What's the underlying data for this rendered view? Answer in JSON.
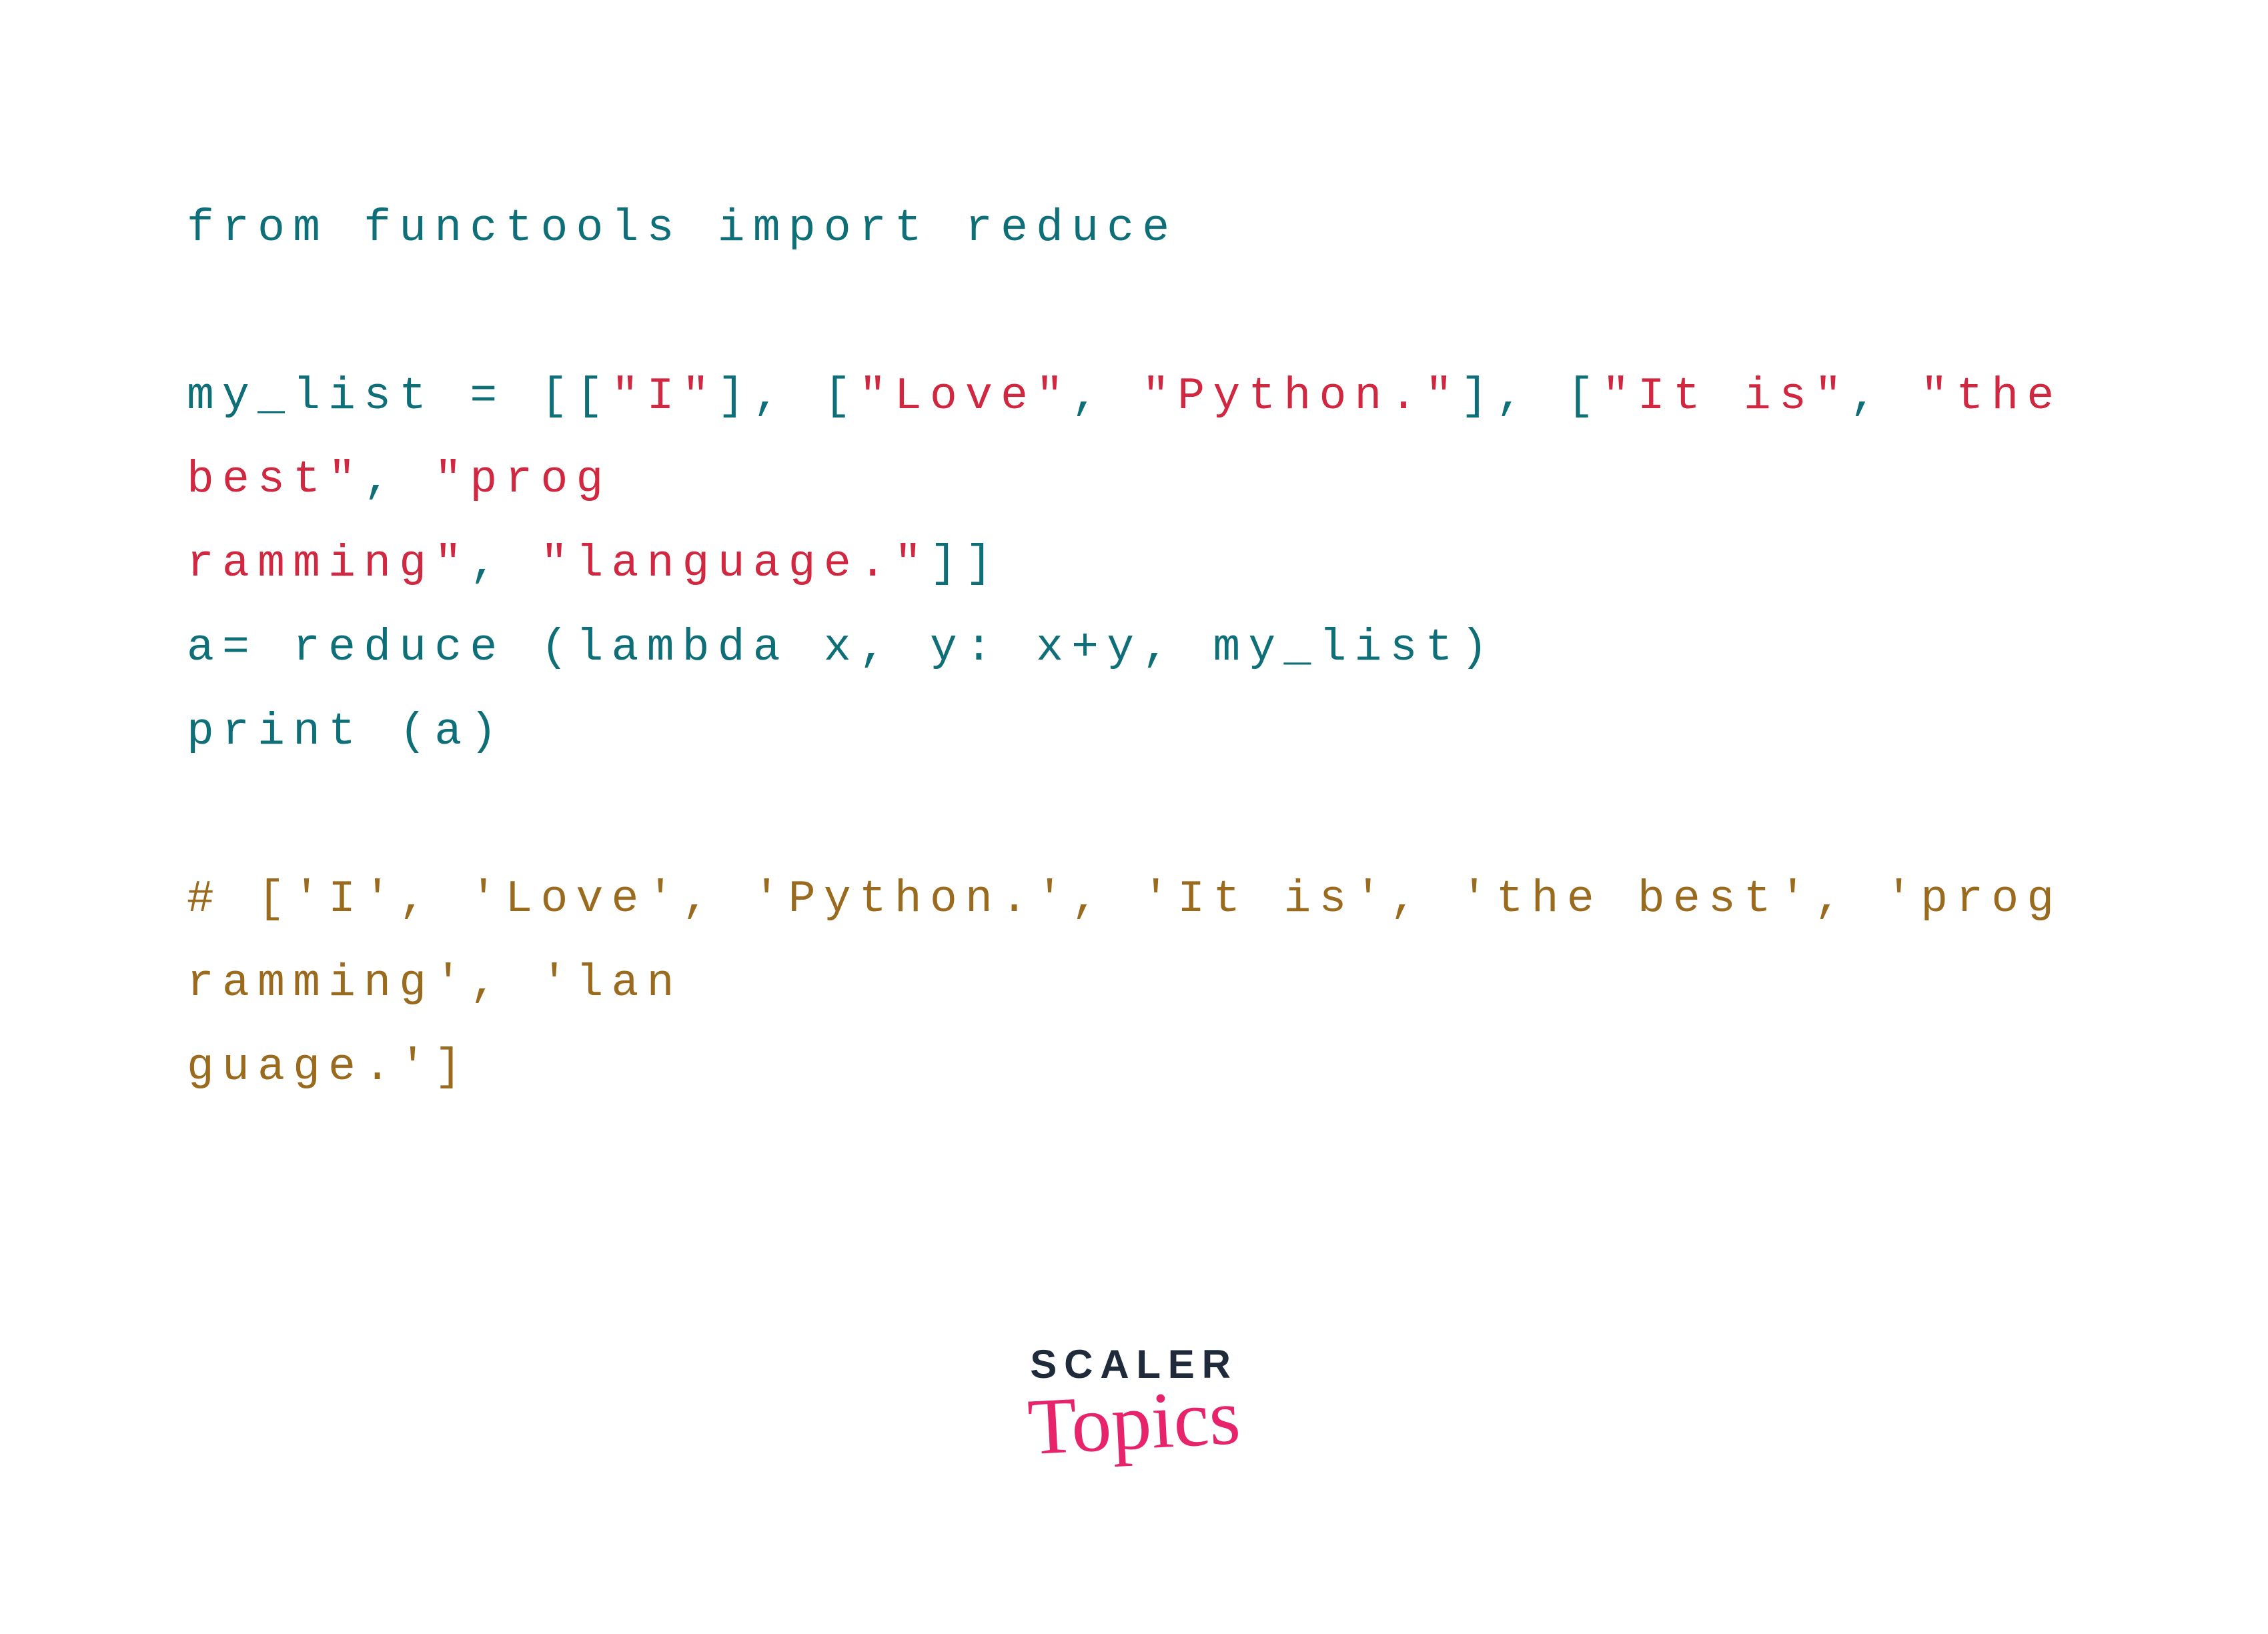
{
  "colors": {
    "teal": "#0f6f78",
    "red": "#d02840",
    "brown": "#9a6b1f",
    "logo_dark": "#1f2a3a",
    "logo_pink": "#e6236b"
  },
  "code_lines": [
    {
      "tokens": [
        {
          "text": "from functools import reduce",
          "color": "teal"
        }
      ]
    },
    {
      "blank": true
    },
    {
      "tokens": [
        {
          "text": "my_list = [[",
          "color": "teal"
        },
        {
          "text": "\"I\"",
          "color": "red"
        },
        {
          "text": "], [",
          "color": "teal"
        },
        {
          "text": "\"Love\"",
          "color": "red"
        },
        {
          "text": ", ",
          "color": "teal"
        },
        {
          "text": "\"Python.\"",
          "color": "red"
        },
        {
          "text": "], [",
          "color": "teal"
        },
        {
          "text": "\"It is\"",
          "color": "red"
        },
        {
          "text": ", ",
          "color": "teal"
        },
        {
          "text": "\"the best\"",
          "color": "red"
        },
        {
          "text": ", ",
          "color": "teal"
        },
        {
          "text": "\"prog",
          "color": "red"
        }
      ]
    },
    {
      "tokens": [
        {
          "text": "ramming\"",
          "color": "red"
        },
        {
          "text": ", ",
          "color": "teal"
        },
        {
          "text": "\"language.\"",
          "color": "red"
        },
        {
          "text": "]]",
          "color": "teal"
        }
      ]
    },
    {
      "tokens": [
        {
          "text": "a= reduce (lambda x, y: x+y, my_list)",
          "color": "teal"
        }
      ]
    },
    {
      "tokens": [
        {
          "text": "print (a)",
          "color": "teal"
        }
      ]
    },
    {
      "blank": true
    },
    {
      "tokens": [
        {
          "text": "# ['I', 'Love', 'Python.', 'It is', 'the best', 'programming', 'lan",
          "color": "brown"
        }
      ]
    },
    {
      "tokens": [
        {
          "text": "guage.']",
          "color": "brown"
        }
      ]
    }
  ],
  "logo": {
    "word": "SCALER",
    "script": "Topics"
  }
}
